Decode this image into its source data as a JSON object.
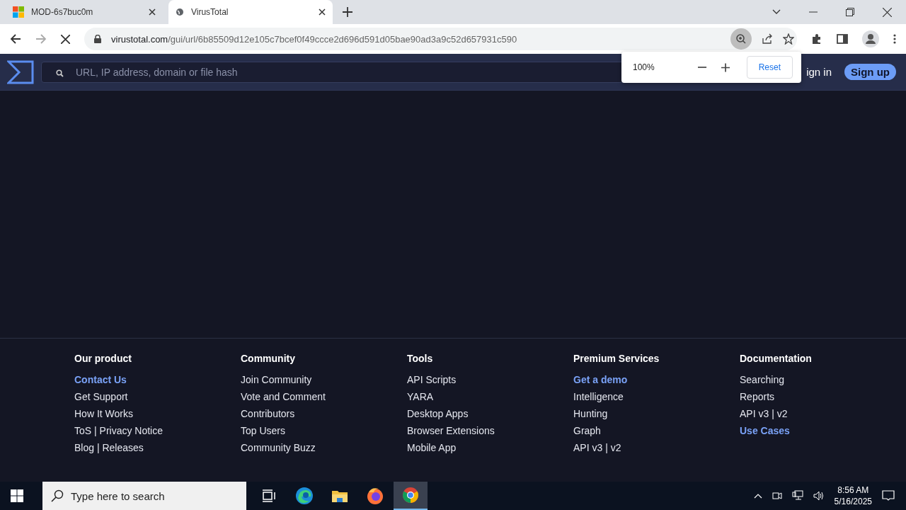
{
  "browser": {
    "tabs": [
      {
        "title": "MOD-6s7buc0m",
        "kind": "windows",
        "selected": false
      },
      {
        "title": "VirusTotal",
        "kind": "globe",
        "selected": true
      }
    ],
    "url_domain": "virustotal.com",
    "url_path": "/gui/url/6b85509d12e105c7bcef0f49ccce2d696d591d05bae90ad3a9c52d657931c590",
    "zoom_popup": {
      "level": "100%",
      "reset": "Reset"
    }
  },
  "site": {
    "search": {
      "placeholder": "URL, IP address, domain or file hash"
    },
    "sign_in": "ign in",
    "sign_up": "Sign up"
  },
  "footer": {
    "columns": [
      {
        "heading": "Our product",
        "links": [
          {
            "text": "Contact Us",
            "kind": "featured"
          },
          {
            "text": "Get Support",
            "kind": "plain"
          },
          {
            "text": "How It Works",
            "kind": "plain"
          },
          {
            "text": "ToS | Privacy Notice",
            "kind": "plain"
          },
          {
            "text": "Blog | Releases",
            "kind": "plain"
          }
        ]
      },
      {
        "heading": "Community",
        "links": [
          {
            "text": "Join Community",
            "kind": "plain"
          },
          {
            "text": "Vote and Comment",
            "kind": "plain"
          },
          {
            "text": "Contributors",
            "kind": "plain"
          },
          {
            "text": "Top Users",
            "kind": "plain"
          },
          {
            "text": "Community Buzz",
            "kind": "plain"
          }
        ]
      },
      {
        "heading": "Tools",
        "links": [
          {
            "text": "API Scripts",
            "kind": "plain"
          },
          {
            "text": "YARA",
            "kind": "plain"
          },
          {
            "text": "Desktop Apps",
            "kind": "plain"
          },
          {
            "text": "Browser Extensions",
            "kind": "plain"
          },
          {
            "text": "Mobile App",
            "kind": "plain"
          }
        ]
      },
      {
        "heading": "Premium Services",
        "links": [
          {
            "text": "Get a demo",
            "kind": "featured"
          },
          {
            "text": "Intelligence",
            "kind": "plain"
          },
          {
            "text": "Hunting",
            "kind": "plain"
          },
          {
            "text": "Graph",
            "kind": "plain"
          },
          {
            "text": "API v3 | v2",
            "kind": "plain"
          }
        ]
      },
      {
        "heading": "Documentation",
        "links": [
          {
            "text": "Searching",
            "kind": "plain"
          },
          {
            "text": "Reports",
            "kind": "plain"
          },
          {
            "text": "API v3 | v2",
            "kind": "plain"
          },
          {
            "text": "Use Cases",
            "kind": "featured"
          }
        ]
      }
    ]
  },
  "taskbar": {
    "search": {
      "placeholder": "Type here to search"
    },
    "apps": [
      {
        "kind": "taskview",
        "selected": false
      },
      {
        "kind": "edge",
        "selected": false
      },
      {
        "kind": "explorer",
        "selected": false
      },
      {
        "kind": "firefox",
        "selected": false
      },
      {
        "kind": "chrome",
        "selected": true
      }
    ],
    "time": "8:56 AM",
    "date": "5/16/2025"
  }
}
